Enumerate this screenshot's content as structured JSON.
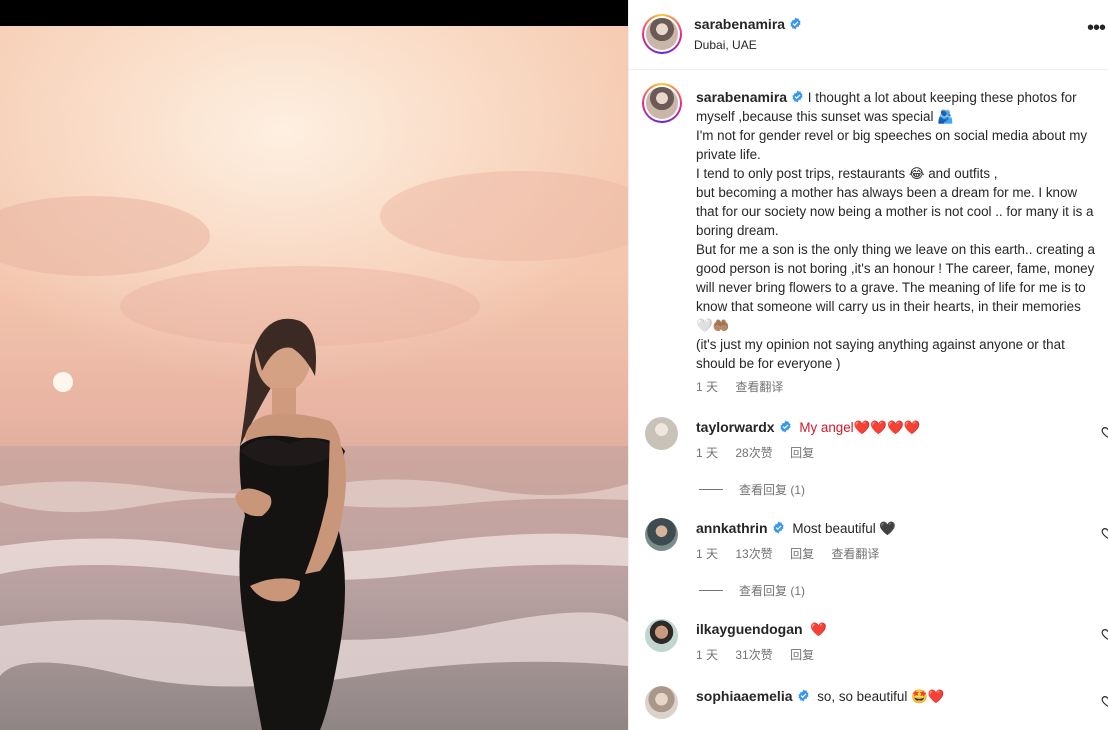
{
  "post": {
    "author": "sarabenamira",
    "location": "Dubai, UAE",
    "caption_lines": [
      "I thought a lot about keeping these photos for myself ,because this sunset was special 🫂",
      "I'm not for gender revel or big speeches on social media about my private life.",
      "I tend to only post trips, restaurants 😂 and outfits ,",
      "but becoming a mother has always been a dream for me. I know that for our society now being a mother is not cool .. for many it is a boring dream.",
      "But for me a son is the only thing we leave on this earth.. creating a good person is not boring ,it's an honour ! The career, fame, money will never bring flowers to a grave. The meaning of life for me is to know that someone will carry us in their hearts, in their memories 🤍🤲🏽",
      "(it's just my opinion not saying anything against anyone or that should be for everyone )"
    ],
    "time": "1 天",
    "translate": "查看翻译"
  },
  "comments": [
    {
      "user": "taylorwardx",
      "text": "My angel❤️❤️❤️❤️",
      "time": "1 天",
      "likes": "28次赞",
      "reply": "回复",
      "translate": "",
      "view_replies": "查看回复 (1)"
    },
    {
      "user": "annkathrin",
      "text": "Most beautiful 🖤",
      "time": "1 天",
      "likes": "13次赞",
      "reply": "回复",
      "translate": "查看翻译",
      "view_replies": "查看回复 (1)"
    },
    {
      "user": "ilkayguendogan",
      "text": "❤️",
      "time": "1 天",
      "likes": "31次赞",
      "reply": "回复",
      "translate": "",
      "view_replies": ""
    },
    {
      "user": "sophiaaemelia",
      "text": "so, so beautiful 🤩❤️",
      "time": "",
      "likes": "",
      "reply": "",
      "translate": "",
      "view_replies": ""
    }
  ],
  "icons": {
    "verified": "verified-badge-icon",
    "more": "more-options-icon",
    "like": "heart-outline-icon"
  },
  "colors": {
    "verified": "#3797f0",
    "muted": "#737373",
    "text": "#262626"
  }
}
